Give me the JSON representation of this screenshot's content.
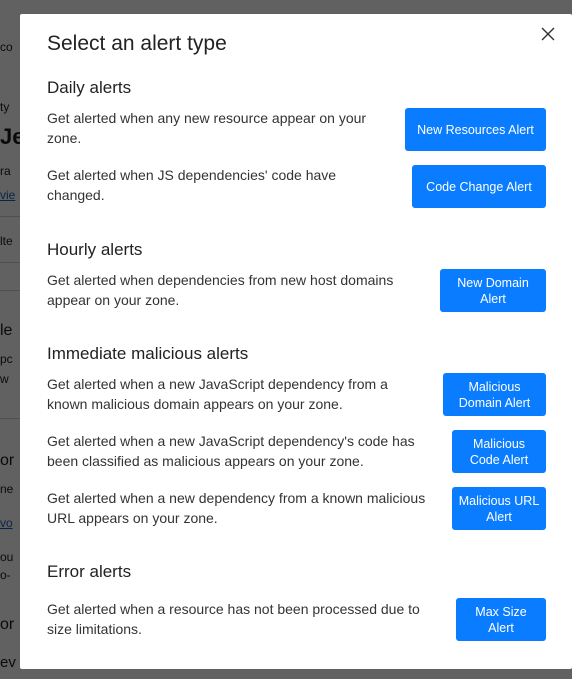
{
  "background": {
    "fragments": [
      "co",
      "ty",
      "Je",
      "ra",
      "vie",
      "lte",
      "le",
      "pc",
      "w",
      "or",
      "ne",
      "vo",
      "ou",
      "o-",
      "or",
      "ev"
    ]
  },
  "modal": {
    "title": "Select an alert type",
    "close_icon": "close-icon",
    "sections": [
      {
        "title": "Daily alerts",
        "alerts": [
          {
            "description": "Get alerted when any new resource appear on your zone.",
            "button": "New Resources Alert"
          },
          {
            "description": "Get alerted when JS dependencies' code have changed.",
            "button": "Code Change Alert"
          }
        ]
      },
      {
        "title": "Hourly alerts",
        "alerts": [
          {
            "description": "Get alerted when dependencies from new host domains appear on your zone.",
            "button": "New Domain Alert"
          }
        ]
      },
      {
        "title": "Immediate malicious alerts",
        "alerts": [
          {
            "description": "Get alerted when a new JavaScript dependency from a known malicious domain appears on your zone.",
            "button": "Malicious Domain Alert"
          },
          {
            "description": "Get alerted when a new JavaScript dependency's code has been classified as malicious appears on your zone.",
            "button": "Malicious Code Alert"
          },
          {
            "description": "Get alerted when a new dependency from a known malicious URL appears on your zone.",
            "button": "Malicious URL Alert"
          }
        ]
      },
      {
        "title": "Error alerts",
        "alerts": [
          {
            "description": "Get alerted when a resource has not been processed due to size limitations.",
            "button": "Max Size Alert"
          }
        ]
      }
    ]
  },
  "colors": {
    "button": "#0a7cff",
    "overlay": "#5f5f5f"
  }
}
